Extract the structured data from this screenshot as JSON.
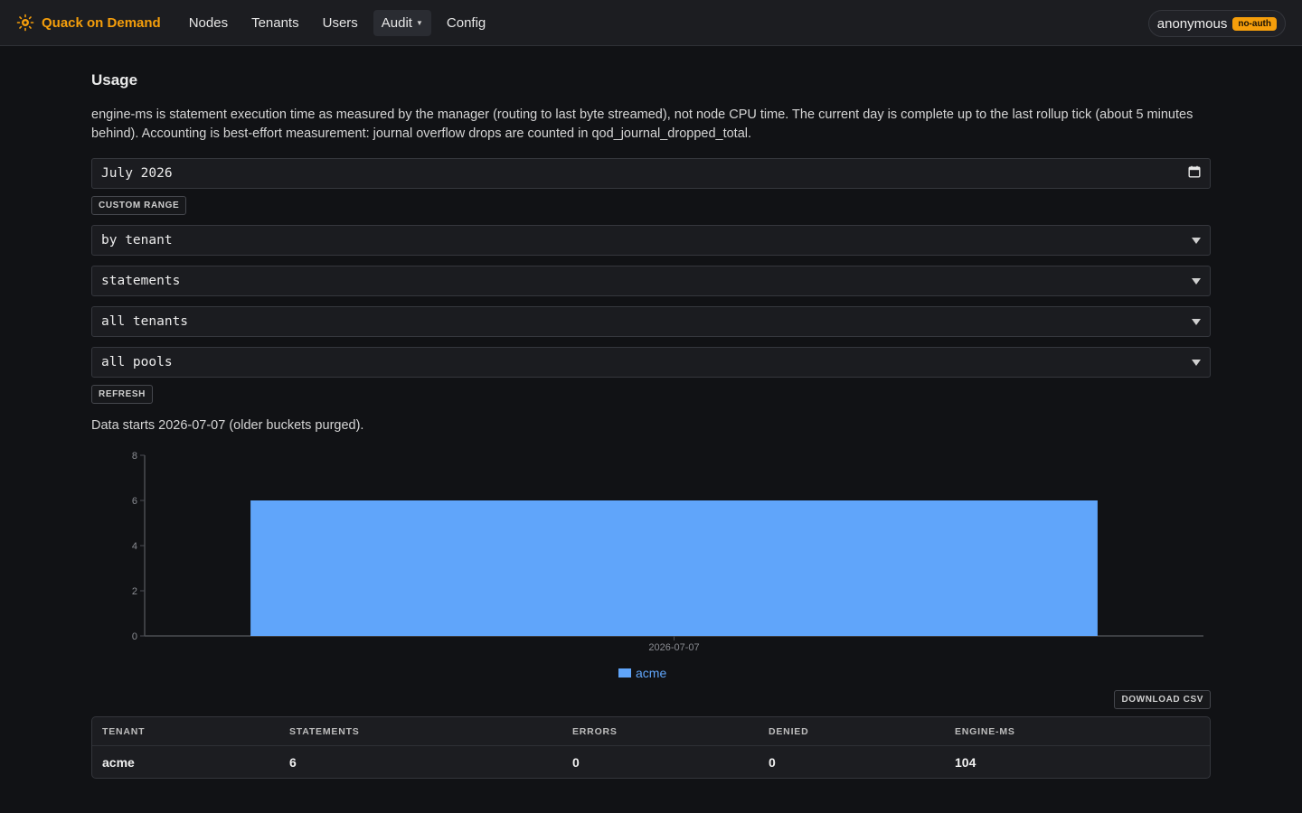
{
  "app": {
    "name": "Quack on Demand",
    "colors": {
      "brand": "#f59e0b",
      "accent": "#60a5fa",
      "background": "#111215"
    }
  },
  "nav": {
    "items": [
      {
        "label": "Nodes"
      },
      {
        "label": "Tenants"
      },
      {
        "label": "Users"
      },
      {
        "label": "Audit",
        "has_dropdown": true,
        "active": true
      },
      {
        "label": "Config"
      }
    ]
  },
  "user": {
    "name": "anonymous",
    "badge": "no-auth"
  },
  "page": {
    "title": "Usage",
    "description": "engine-ms is statement execution time as measured by the manager (routing to last byte streamed), not node CPU time. The current day is complete up to the last rollup tick (about 5 minutes behind). Accounting is best-effort measurement: journal overflow drops are counted in qod_journal_dropped_total."
  },
  "filters": {
    "month": {
      "value": "July 2026",
      "icon": "calendar-icon"
    },
    "custom_range_label": "CUSTOM RANGE",
    "group_by": {
      "value": "by tenant"
    },
    "metric": {
      "value": "statements"
    },
    "tenant": {
      "value": "all tenants"
    },
    "pool": {
      "value": "all pools"
    },
    "refresh_label": "REFRESH"
  },
  "data_note": "Data starts 2026-07-07 (older buckets purged).",
  "chart_data": {
    "type": "bar",
    "categories": [
      "2026-07-07"
    ],
    "series": [
      {
        "name": "acme",
        "values": [
          6
        ],
        "color": "#60a5fa"
      }
    ],
    "ylim": [
      0,
      8
    ],
    "yticks": [
      0,
      2,
      4,
      6,
      8
    ],
    "xlabel": "",
    "ylabel": "",
    "grid": false,
    "legend": "bottom-center"
  },
  "download_csv_label": "DOWNLOAD CSV",
  "table": {
    "columns": [
      "TENANT",
      "STATEMENTS",
      "ERRORS",
      "DENIED",
      "ENGINE-MS"
    ],
    "rows": [
      [
        "acme",
        "6",
        "0",
        "0",
        "104"
      ]
    ]
  }
}
